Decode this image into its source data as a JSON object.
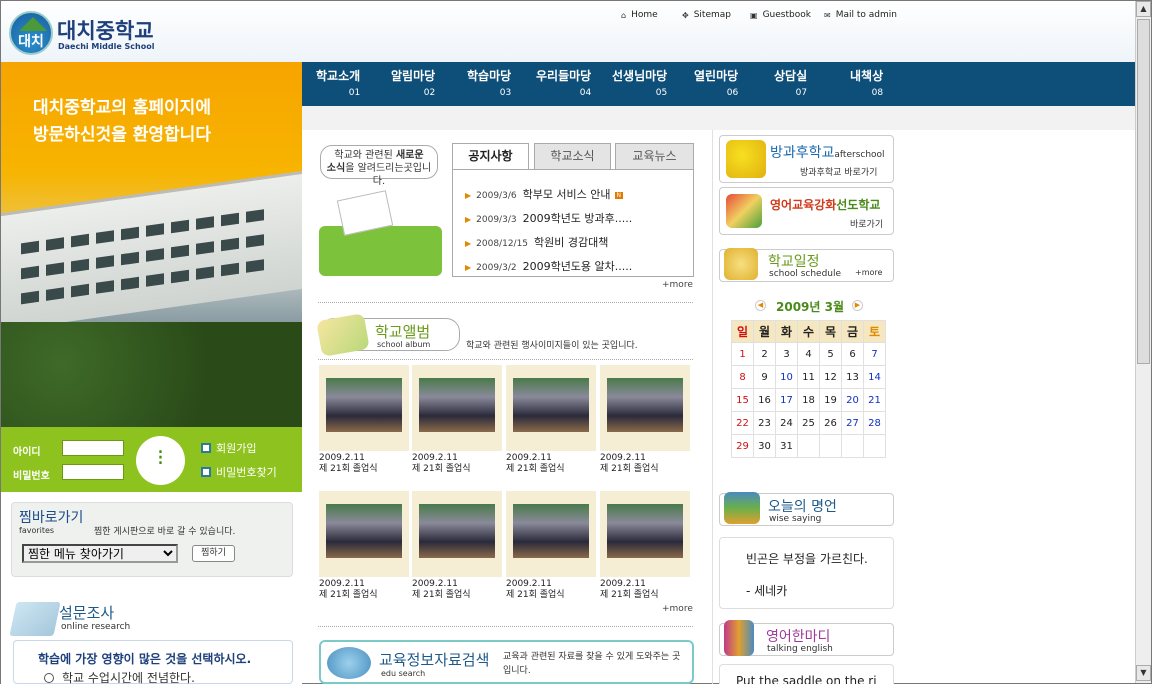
{
  "header": {
    "logo_emblem": "대치",
    "school_name": "대치중학교",
    "school_name_en": "Daechi Middle School",
    "links": [
      "Home",
      "Sitemap",
      "Guestbook",
      "Mail to admin"
    ]
  },
  "nav": [
    {
      "label": "학교소개",
      "num": "01"
    },
    {
      "label": "알림마당",
      "num": "02"
    },
    {
      "label": "학습마당",
      "num": "03"
    },
    {
      "label": "우리들마당",
      "num": "04"
    },
    {
      "label": "선생님마당",
      "num": "05"
    },
    {
      "label": "열린마당",
      "num": "06"
    },
    {
      "label": "상담실",
      "num": "07"
    },
    {
      "label": "내책상",
      "num": "08"
    }
  ],
  "welcome": {
    "line1": "대치중학교의 홈페이지에",
    "line2": "방문하신것을 환영합니다"
  },
  "login": {
    "id_label": "아이디",
    "pw_label": "비밀번호",
    "join": "회원가입",
    "find_pw": "비밀번호찾기"
  },
  "favorites": {
    "title": "찜바로가기",
    "subtitle": "favorites",
    "desc": "찜한 게시판으로 바로 갈 수 있습니다.",
    "select_value": "찜한 메뉴 찾아가기",
    "button": "찜하기"
  },
  "survey": {
    "title": "설문조사",
    "subtitle": "online research",
    "question": "학습에 가장 영향이 많은 것을 선택하시오.",
    "option1": "학교 수업시간에 전념한다."
  },
  "notice": {
    "bubble_line1": "학교와 관련된 ",
    "bubble_bold1": "새로운",
    "bubble_bold2": "소식",
    "bubble_line2": "을 알려드리는곳입니다.",
    "tabs": [
      "공지사항",
      "학교소식",
      "교육뉴스"
    ],
    "items": [
      {
        "date": "2009/3/6",
        "title": "학부모 서비스 안내",
        "new": "N"
      },
      {
        "date": "2009/3/3",
        "title": "2009학년도 방과후.....",
        "new": ""
      },
      {
        "date": "2008/12/15",
        "title": "학원비 경감대책",
        "new": ""
      },
      {
        "date": "2009/3/2",
        "title": "2009학년도용 알차.....",
        "new": ""
      }
    ],
    "more": "+more"
  },
  "album": {
    "title": "학교앨범",
    "subtitle": "school album",
    "desc": "학교와 관련된 행사이미지들이 있는 곳입니다.",
    "items": [
      {
        "date": "2009.2.11",
        "caption": "제 21회 졸업식"
      },
      {
        "date": "2009.2.11",
        "caption": "제 21회 졸업식"
      },
      {
        "date": "2009.2.11",
        "caption": "제 21회 졸업식"
      },
      {
        "date": "2009.2.11",
        "caption": "제 21회 졸업식"
      },
      {
        "date": "2009.2.11",
        "caption": "제 21회 졸업식"
      },
      {
        "date": "2009.2.11",
        "caption": "제 21회 졸업식"
      },
      {
        "date": "2009.2.11",
        "caption": "제 21회 졸업식"
      },
      {
        "date": "2009.2.11",
        "caption": "제 21회 졸업식"
      }
    ],
    "more": "+more"
  },
  "edu_search": {
    "title": "교육정보자료검색",
    "subtitle": "edu search",
    "desc": "교육과 관련된 자료를 찾을 수 있게 도와주는 곳입니다."
  },
  "afterschool": {
    "title": "방과후학교",
    "title_en": "afterschool",
    "link": "방과후학교 바로가기"
  },
  "english_school": {
    "title_a": "영어교육강화",
    "title_b": "선도학교",
    "link": "바로가기"
  },
  "schedule": {
    "title": "학교일정",
    "subtitle": "school schedule",
    "more": "+more",
    "month_title": "2009년 3월",
    "weekdays": [
      "일",
      "월",
      "화",
      "수",
      "목",
      "금",
      "토"
    ],
    "weeks": [
      [
        "1",
        "2",
        "3",
        "4",
        "5",
        "6",
        "7"
      ],
      [
        "8",
        "9",
        "10",
        "11",
        "12",
        "13",
        "14"
      ],
      [
        "15",
        "16",
        "17",
        "18",
        "19",
        "20",
        "21"
      ],
      [
        "22",
        "23",
        "24",
        "25",
        "26",
        "27",
        "28"
      ],
      [
        "29",
        "30",
        "31",
        "",
        "",
        "",
        ""
      ]
    ]
  },
  "wise_saying": {
    "title": "오늘의 명언",
    "subtitle": "wise saying",
    "quote": "빈곤은 부정을 가르친다.",
    "author": "- 세네카"
  },
  "talking_english": {
    "title": "영어한마디",
    "subtitle": "talking english",
    "text": "Put the saddle on the ri"
  },
  "colors": {
    "nav_bg": "#0e4f7a",
    "login_bg": "#8ec21e",
    "accent_orange": "#f7a400",
    "green_title": "#6a9a1a"
  }
}
